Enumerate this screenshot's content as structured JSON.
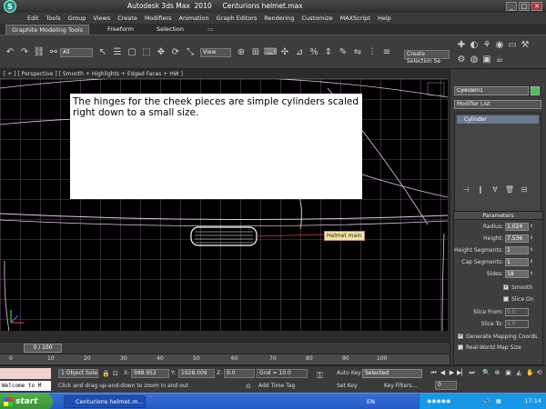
{
  "window": {
    "title": "Autodesk 3ds Max  2010     Centurions helmet.max",
    "min": "_",
    "max": "□",
    "close": "✕"
  },
  "menu": [
    "Edit",
    "Tools",
    "Group",
    "Views",
    "Create",
    "Modifiers",
    "Animation",
    "Graph Editors",
    "Rendering",
    "Customize",
    "MAXScript",
    "Help"
  ],
  "ribbon": {
    "tab_graphite": "Graphite Modeling Tools",
    "tab_freeform": "Freeform",
    "tab_selection": "Selection"
  },
  "toolbar": {
    "filter_value": "All",
    "ref_coord": "View",
    "named_selection": "Create Selection Se"
  },
  "viewport": {
    "label": "[ + ] [ Perspective ] [ Smooth + Highlights + Edged Faces + HW ]",
    "annotation": "The hinges for the cheek pieces are simple cylinders scaled right down to a small size.",
    "object_tag": "Helmet main"
  },
  "command_panel": {
    "object_name": "Cylinder01",
    "object_color": "#49c05a",
    "modifier_list": "Modifier List",
    "stack_item": "Cylinder",
    "params_title": "Parameters",
    "params": [
      {
        "label": "Radius:",
        "value": "1.024"
      },
      {
        "label": "Height:",
        "value": "7.536"
      },
      {
        "label": "Height Segments:",
        "value": "1"
      },
      {
        "label": "Cap Segments:",
        "value": "1"
      },
      {
        "label": "Sides:",
        "value": "18"
      }
    ],
    "smooth_label": "Smooth",
    "slice_on_label": "Slice On",
    "slice_from_label": "Slice From:",
    "slice_from_value": "0.0",
    "slice_to_label": "Slice To:",
    "slice_to_value": "0.0",
    "gen_mapping_label": "Generate Mapping Coords.",
    "real_world_label": "Real-World Map Size"
  },
  "timeline": {
    "slider": "0 / 100",
    "ticks": [
      "0",
      "10",
      "20",
      "30",
      "40",
      "50",
      "60",
      "70",
      "80",
      "90",
      "100"
    ]
  },
  "status": {
    "maxscript": "Welcome to M",
    "selection_count": "1 Object Sele",
    "x_label": "X:",
    "x_value": "988.952",
    "y_label": "Y:",
    "y_value": "1928.009",
    "z_label": "Z:",
    "z_value": "0.0",
    "grid": "Grid = 10.0",
    "auto_key": "Auto Key",
    "selected": "Selected",
    "set_key": "Set Key",
    "key_filters": "Key Filters...",
    "prompt": "Click and drag up-and-down to zoom in and out",
    "add_time_tag": "Add Time Tag",
    "frame": "0"
  },
  "taskbar": {
    "start": "start",
    "app": "Centurions helmet.m...",
    "lang": "EN",
    "clock": "17:14"
  }
}
